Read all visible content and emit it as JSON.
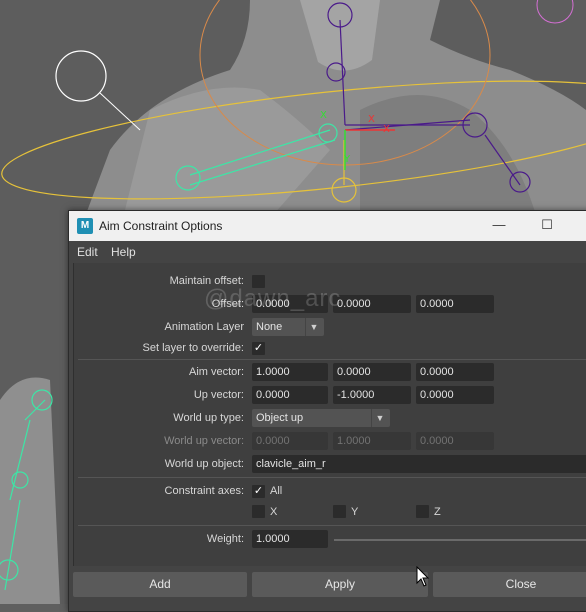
{
  "dialog": {
    "title": "Aim Constraint Options",
    "app_icon_label": "M",
    "menu": [
      "Edit",
      "Help"
    ]
  },
  "watermark": "@dawn_arc",
  "form": {
    "maintain_offset_label": "Maintain offset:",
    "maintain_offset_checked": false,
    "offset_label": "Offset:",
    "offset": [
      "0.0000",
      "0.0000",
      "0.0000"
    ],
    "animation_layer_label": "Animation Layer",
    "animation_layer_value": "None",
    "set_layer_label": "Set layer to override:",
    "set_layer_checked": true,
    "aim_vector_label": "Aim vector:",
    "aim_vector": [
      "1.0000",
      "0.0000",
      "0.0000"
    ],
    "up_vector_label": "Up vector:",
    "up_vector": [
      "0.0000",
      "-1.0000",
      "0.0000"
    ],
    "world_up_type_label": "World up type:",
    "world_up_type_value": "Object up",
    "world_up_vector_label": "World up vector:",
    "world_up_vector": [
      "0.0000",
      "1.0000",
      "0.0000"
    ],
    "world_up_object_label": "World up object:",
    "world_up_object_value": "clavicle_aim_r",
    "constraint_axes_label": "Constraint axes:",
    "axes": {
      "all": "All",
      "x": "X",
      "y": "Y",
      "z": "Z"
    },
    "axes_checked": {
      "all": true,
      "x": false,
      "y": false,
      "z": false
    },
    "weight_label": "Weight:",
    "weight_value": "1.0000"
  },
  "buttons": {
    "add": "Add",
    "apply": "Apply",
    "close": "Close"
  },
  "colors": {
    "joint_green": "#3de6a6",
    "joint_purple": "#4a1a8a",
    "curve_yellow": "#e6c23a",
    "curve_orange": "#d88a4a"
  }
}
